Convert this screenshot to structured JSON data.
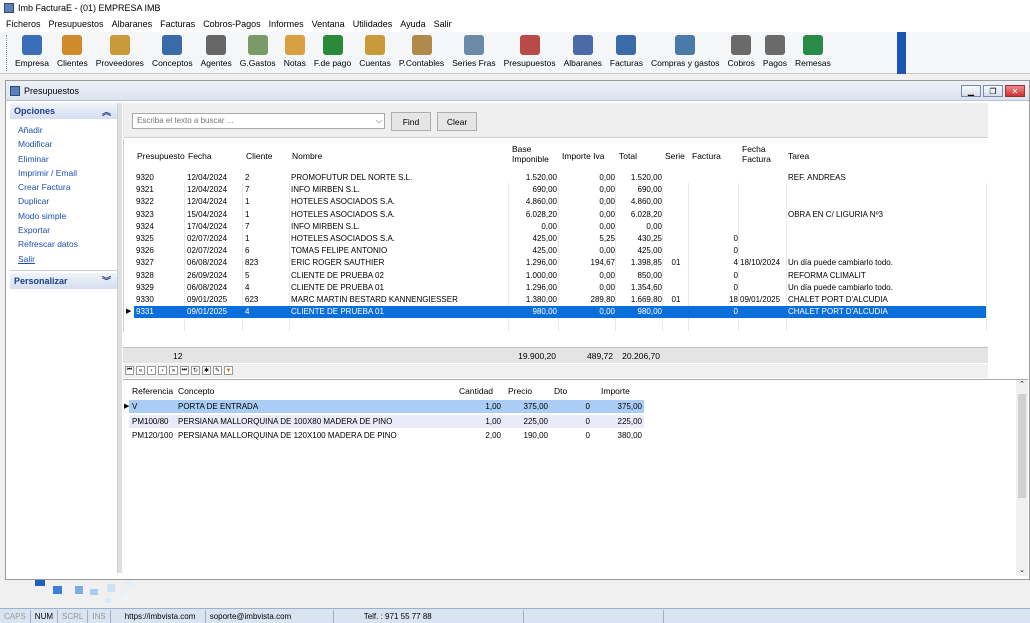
{
  "window": {
    "title": "Imb FacturaE - (01)  EMPRESA IMB"
  },
  "menu": [
    "Ficheros",
    "Presupuestos",
    "Albaranes",
    "Facturas",
    "Cobros-Pagos",
    "Informes",
    "Ventana",
    "Utilidades",
    "Ayuda",
    "Salir"
  ],
  "toolbar": [
    {
      "label": "Empresa",
      "icon": "monitor-icon",
      "color": "#3a6fb8"
    },
    {
      "label": "Clientes",
      "icon": "users-icon",
      "color": "#d08a2a"
    },
    {
      "label": "Proveedores",
      "icon": "supplier-icon",
      "color": "#c89a3a"
    },
    {
      "label": "Conceptos",
      "icon": "store-icon",
      "color": "#3a6aa8"
    },
    {
      "label": "Agentes",
      "icon": "agents-icon",
      "color": "#666666"
    },
    {
      "label": "G.Gastos",
      "icon": "spreadsheet-icon",
      "color": "#7a9a6a"
    },
    {
      "label": "Notas",
      "icon": "folder-icon",
      "color": "#d8a040"
    },
    {
      "label": "F.de pago",
      "icon": "euro-coin-icon",
      "color": "#2a8a3a"
    },
    {
      "label": "Cuentas",
      "icon": "ledger-icon",
      "color": "#c89a3a"
    },
    {
      "label": "P.Contables",
      "icon": "accounting-icon",
      "color": "#b08a4a"
    },
    {
      "label": "Series Fras",
      "icon": "series-icon",
      "color": "#6a8aa8"
    },
    {
      "label": "Presupuestos",
      "icon": "budget-document-icon",
      "color": "#b84a4a"
    },
    {
      "label": "Albaranes",
      "icon": "delivery-note-icon",
      "color": "#4a6aa8"
    },
    {
      "label": "Facturas",
      "icon": "invoice-icon",
      "color": "#3a6aa8"
    },
    {
      "label": "Compras y gastos",
      "icon": "binders-icon",
      "color": "#4a7aa8"
    },
    {
      "label": "Cobros",
      "icon": "bank-in-icon",
      "color": "#6a6a6a"
    },
    {
      "label": "Pagos",
      "icon": "bank-out-icon",
      "color": "#6a6a6a"
    },
    {
      "label": "Remesas",
      "icon": "bank-green-icon",
      "color": "#2a8a4a"
    }
  ],
  "child_window": {
    "title": "Presupuestos"
  },
  "sidebar": {
    "opciones_title": "Opciones",
    "items": [
      "Añadir",
      "Modificar",
      "Eliminar",
      "Imprimir / Email",
      "Crear Factura",
      "Duplicar",
      "Modo simple",
      "Exportar",
      "Refrescar datos",
      "Salir"
    ],
    "personalizar_title": "Personalizar"
  },
  "search": {
    "placeholder": "Escriba el texto a buscar ...",
    "find_label": "Find",
    "clear_label": "Clear"
  },
  "table": {
    "headers": {
      "presupuesto": "Presupuesto",
      "fecha": "Fecha",
      "cliente": "Cliente",
      "nombre": "Nombre",
      "base1": "Base",
      "base2": "Imponible",
      "iva": "Importe Iva",
      "total": "Total",
      "serie": "Serie",
      "factura": "Factura",
      "ff1": "Fecha",
      "ff2": "Factura",
      "tarea": "Tarea"
    },
    "rows": [
      {
        "presupuesto": "9320",
        "fecha": "12/04/2024",
        "cliente": "2",
        "nombre": "PROMOFUTUR DEL NORTE S.L.",
        "base": "1.520,00",
        "iva": "0,00",
        "total": "1.520,00",
        "serie": "",
        "factura": "",
        "fecha_factura": "",
        "tarea": "REF. ANDREAS"
      },
      {
        "presupuesto": "9321",
        "fecha": "12/04/2024",
        "cliente": "7",
        "nombre": "INFO MIRBEN S.L.",
        "base": "690,00",
        "iva": "0,00",
        "total": "690,00",
        "serie": "",
        "factura": "",
        "fecha_factura": "",
        "tarea": ""
      },
      {
        "presupuesto": "9322",
        "fecha": "12/04/2024",
        "cliente": "1",
        "nombre": "HOTELES ASOCIADOS S.A.",
        "base": "4.860,00",
        "iva": "0,00",
        "total": "4.860,00",
        "serie": "",
        "factura": "",
        "fecha_factura": "",
        "tarea": ""
      },
      {
        "presupuesto": "9323",
        "fecha": "15/04/2024",
        "cliente": "1",
        "nombre": "HOTELES ASOCIADOS S.A.",
        "base": "6.028,20",
        "iva": "0,00",
        "total": "6.028,20",
        "serie": "",
        "factura": "",
        "fecha_factura": "",
        "tarea": "OBRA EN C/ LIGURIA Nº3"
      },
      {
        "presupuesto": "9324",
        "fecha": "17/04/2024",
        "cliente": "7",
        "nombre": "INFO MIRBEN S.L.",
        "base": "0,00",
        "iva": "0,00",
        "total": "0,00",
        "serie": "",
        "factura": "",
        "fecha_factura": "",
        "tarea": ""
      },
      {
        "presupuesto": "9325",
        "fecha": "02/07/2024",
        "cliente": "1",
        "nombre": "HOTELES ASOCIADOS S.A.",
        "base": "425,00",
        "iva": "5,25",
        "total": "430,25",
        "serie": "",
        "factura": "0",
        "fecha_factura": "",
        "tarea": ""
      },
      {
        "presupuesto": "9326",
        "fecha": "02/07/2024",
        "cliente": "6",
        "nombre": "TOMAS FELIPE ANTONIO",
        "base": "425,00",
        "iva": "0,00",
        "total": "425,00",
        "serie": "",
        "factura": "0",
        "fecha_factura": "",
        "tarea": ""
      },
      {
        "presupuesto": "9327",
        "fecha": "06/08/2024",
        "cliente": "823",
        "nombre": "ERIC ROGER SAUTHIER",
        "base": "1.296,00",
        "iva": "194,67",
        "total": "1.398,85",
        "serie": "01",
        "factura": "4",
        "fecha_factura": "18/10/2024",
        "tarea": "Un día puede cambiarlo todo."
      },
      {
        "presupuesto": "9328",
        "fecha": "26/09/2024",
        "cliente": "5",
        "nombre": "CLIENTE DE PRUEBA 02",
        "base": "1.000,00",
        "iva": "0,00",
        "total": "850,00",
        "serie": "",
        "factura": "0",
        "fecha_factura": "",
        "tarea": "REFORMA CLIMALIT"
      },
      {
        "presupuesto": "9329",
        "fecha": "06/08/2024",
        "cliente": "4",
        "nombre": "CLIENTE DE PRUEBA 01",
        "base": "1.296,00",
        "iva": "0,00",
        "total": "1.354,60",
        "serie": "",
        "factura": "0",
        "fecha_factura": "",
        "tarea": "Un día puede cambiarlo todo."
      },
      {
        "presupuesto": "9330",
        "fecha": "09/01/2025",
        "cliente": "623",
        "nombre": "MARC MARTIN BESTARD KANNENGIESSER",
        "base": "1.380,00",
        "iva": "289,80",
        "total": "1.669,80",
        "serie": "01",
        "factura": "18",
        "fecha_factura": "09/01/2025",
        "tarea": "CHALET PORT D'ALCUDIA"
      },
      {
        "presupuesto": "9331",
        "fecha": "09/01/2025",
        "cliente": "4",
        "nombre": "CLIENTE DE PRUEBA 01",
        "base": "980,00",
        "iva": "0,00",
        "total": "980,00",
        "serie": "",
        "factura": "0",
        "fecha_factura": "",
        "tarea": "CHALET PORT D'ALCUDIA"
      }
    ],
    "totals": {
      "count": "12",
      "base": "19.900,20",
      "iva": "489,72",
      "total": "20.206,70"
    }
  },
  "detail": {
    "headers": {
      "referencia": "Referencia",
      "concepto": "Concepto",
      "cantidad": "Cantidad",
      "precio": "Precio",
      "dto": "Dto",
      "importe": "Importe"
    },
    "rows": [
      {
        "referencia": "V",
        "concepto": "PORTA DE ENTRADA",
        "cantidad": "1,00",
        "precio": "375,00",
        "dto": "0",
        "importe": "375,00"
      },
      {
        "referencia": "PM100/80",
        "concepto": "PERSIANA MALLORQUINA DE 100X80 MADERA DE PINO",
        "cantidad": "1,00",
        "precio": "225,00",
        "dto": "0",
        "importe": "225,00"
      },
      {
        "referencia": "PM120/100",
        "concepto": "PERSIANA MALLORQUINA DE 120X100 MADERA DE PINO",
        "cantidad": "2,00",
        "precio": "190,00",
        "dto": "0",
        "importe": "380,00"
      }
    ]
  },
  "statusbar": {
    "caps": "CAPS",
    "num": "NUM",
    "scrl": "SCRL",
    "ins": "INS",
    "web": "https://imbvista.com",
    "email": "soporte@imbvista.com",
    "phone": "Telf. : 971 55 77 88"
  }
}
